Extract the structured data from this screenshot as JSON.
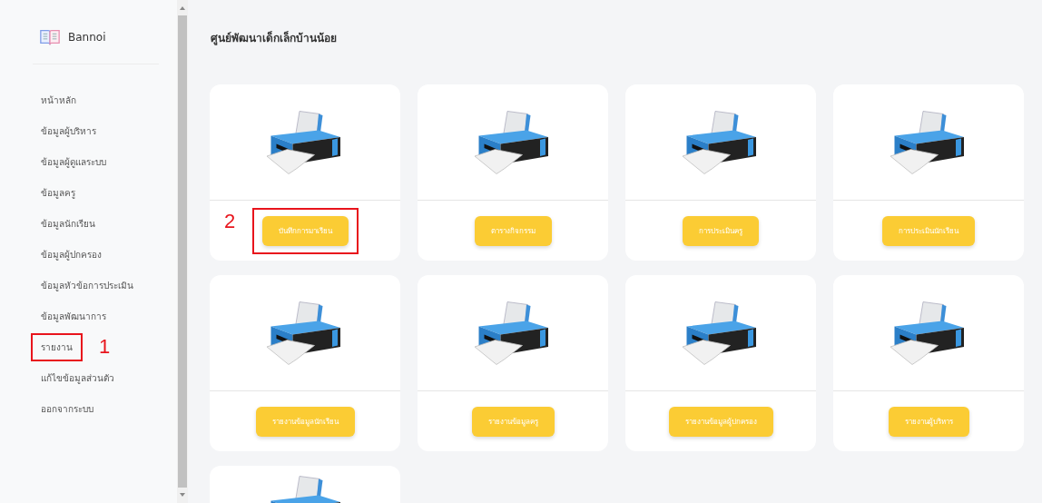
{
  "brand": {
    "name": "Bannoi"
  },
  "sidebar": {
    "items": [
      {
        "label": "หน้าหลัก"
      },
      {
        "label": "ข้อมูลผู้บริหาร"
      },
      {
        "label": "ข้อมูลผู้ดูแลระบบ"
      },
      {
        "label": "ข้อมูลครู"
      },
      {
        "label": "ข้อมูลนักเรียน"
      },
      {
        "label": "ข้อมูลผู้ปกครอง"
      },
      {
        "label": "ข้อมูลหัวข้อการประเมิน"
      },
      {
        "label": "ข้อมูลพัฒนาการ"
      },
      {
        "label": "รายงาน",
        "callout": "1"
      },
      {
        "label": "แก้ไขข้อมูลส่วนตัว"
      },
      {
        "label": "ออกจากระบบ"
      }
    ]
  },
  "page_title": "ศูนย์พัฒนาเด็กเล็กบ้านน้อย",
  "cards": [
    {
      "kind": "full",
      "button": "บันทึกการมาเรียน",
      "callout": "2"
    },
    {
      "kind": "full",
      "button": "ตารางกิจกรรม"
    },
    {
      "kind": "full",
      "button": "การประเมินครู"
    },
    {
      "kind": "full",
      "button": "การประเมินนักเรียน"
    },
    {
      "kind": "full",
      "button": "รายงานข้อมูลนักเรียน"
    },
    {
      "kind": "full",
      "button": "รายงานข้อมูลครู"
    },
    {
      "kind": "full",
      "button": "รายงานข้อมูลผู้ปกครอง"
    },
    {
      "kind": "full",
      "button": "รายงานผู้บริหาร"
    },
    {
      "kind": "cut"
    }
  ]
}
